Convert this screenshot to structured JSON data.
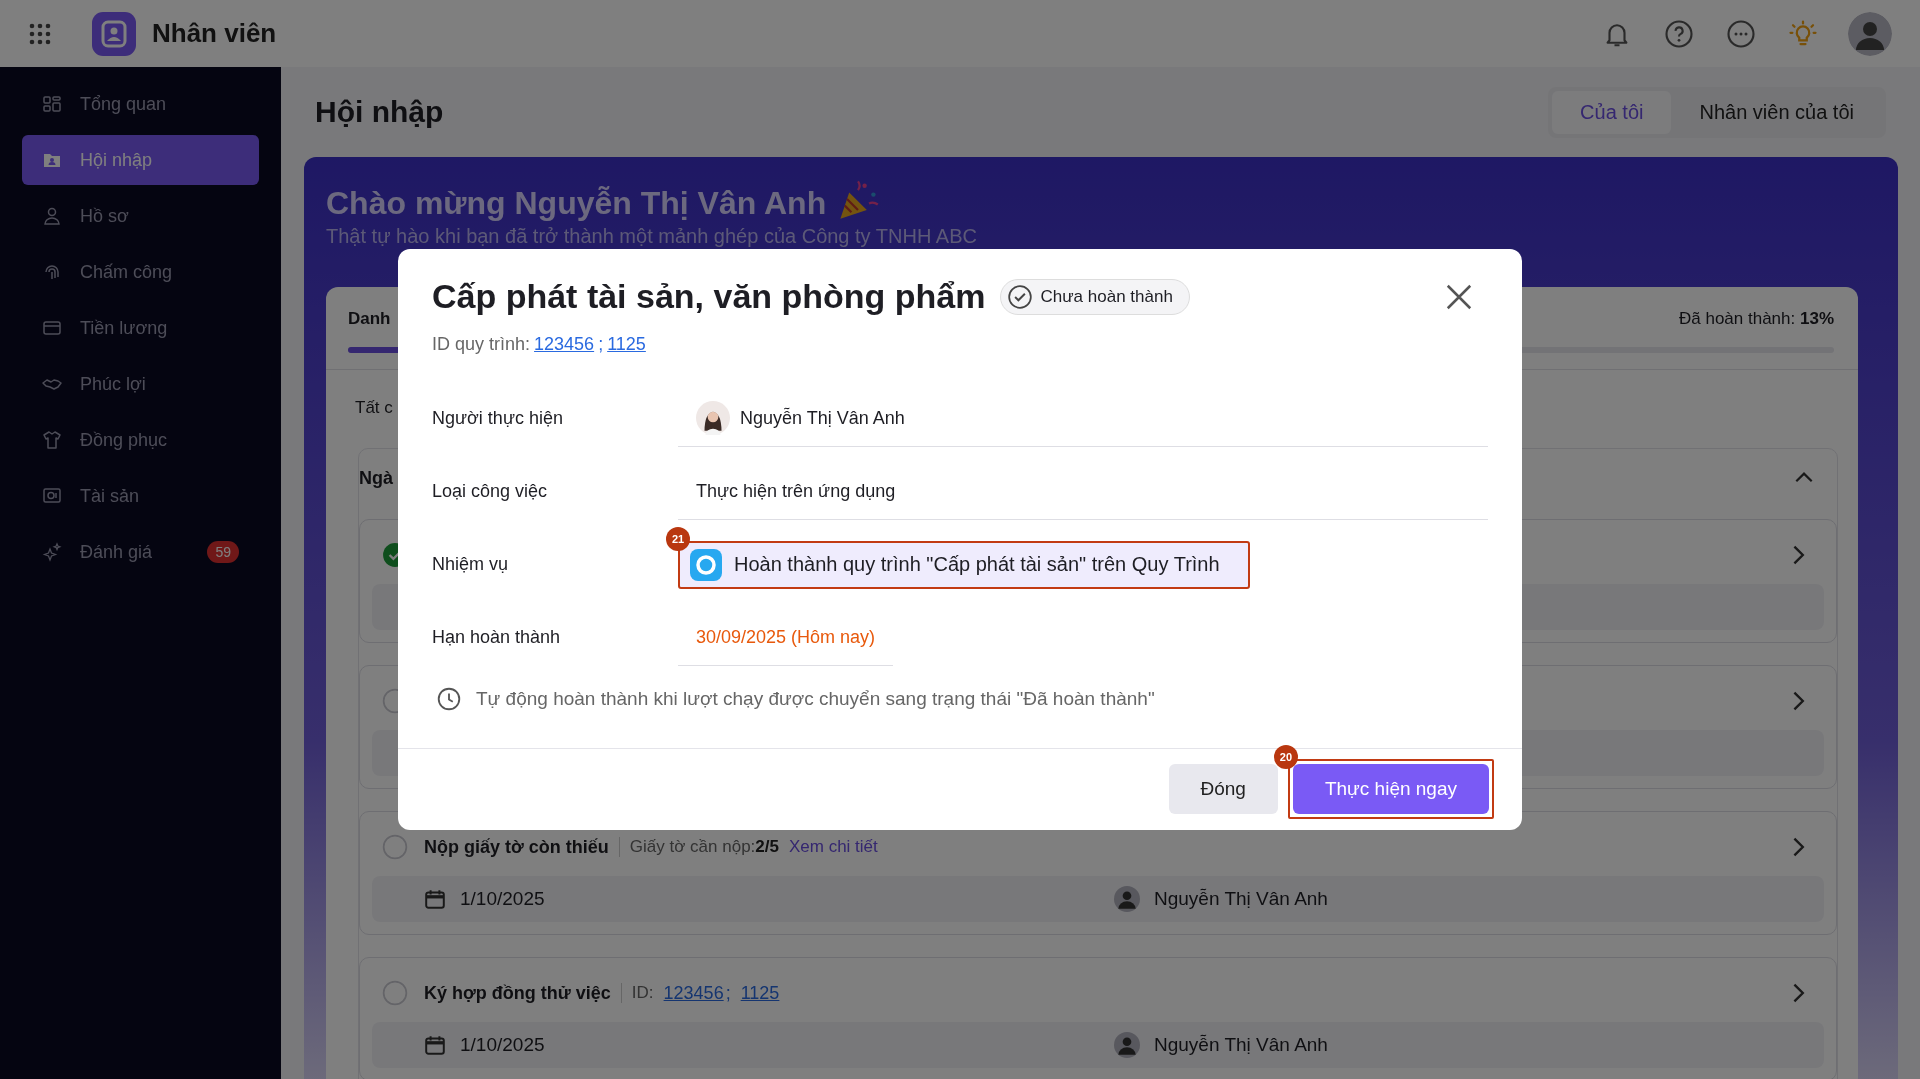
{
  "topbar": {
    "app_name": "Nhân viên"
  },
  "sidebar": {
    "items": [
      {
        "label": "Tổng quan",
        "selected": false
      },
      {
        "label": "Hội nhập",
        "selected": true
      },
      {
        "label": "Hồ sơ",
        "selected": false
      },
      {
        "label": "Chấm công",
        "selected": false
      },
      {
        "label": "Tiền lương",
        "selected": false
      },
      {
        "label": "Phúc lợi",
        "selected": false
      },
      {
        "label": "Đồng phục",
        "selected": false
      },
      {
        "label": "Tài sản",
        "selected": false
      },
      {
        "label": "Đánh giá",
        "selected": false,
        "badge": "59"
      }
    ]
  },
  "page": {
    "title": "Hội nhập",
    "tabs": [
      {
        "label": "Của tôi",
        "selected": true
      },
      {
        "label": "Nhân viên của tôi",
        "selected": false
      }
    ]
  },
  "banner": {
    "title": "Chào mừng Nguyễn Thị Vân Anh",
    "subtitle": "Thật tự hào khi bạn đã trở thành một mảnh ghép của Công ty TNHH ABC"
  },
  "checklist": {
    "tab_label": "Danh",
    "progress_label": "Đã hoàn thành:",
    "progress_value": "13%",
    "level": 0.13,
    "filter": "Tất c",
    "group": {
      "title": "Ngà",
      "expanded": true,
      "items": [
        {
          "checked": true
        },
        {
          "checked": false
        },
        {
          "checked": false,
          "title": "Nộp giấy tờ còn thiếu",
          "meta_label": "Giấy tờ cần nộp:",
          "meta_value": "2/5",
          "link": "Xem chi tiết",
          "date": "1/10/2025",
          "assignee": "Nguyễn Thị Vân Anh"
        },
        {
          "checked": false,
          "title": "Ký hợp đồng thử việc",
          "meta_label": "ID:",
          "ids": [
            "123456",
            "1125"
          ],
          "separator": ";",
          "date": "1/10/2025",
          "assignee": "Nguyễn Thị Vân Anh"
        }
      ]
    }
  },
  "modal": {
    "title": "Cấp phát tài sản, văn phòng phẩm",
    "status": "Chưa hoàn thành",
    "id_label": "ID quy trình:",
    "ids": [
      "123456",
      "1125"
    ],
    "separator": ";",
    "fields": [
      {
        "kind": "person",
        "label": "Người thực hiện",
        "value": "Nguyễn Thị Vân Anh"
      },
      {
        "kind": "text",
        "label": "Loại công việc",
        "value": "Thực hiện trên ứng dụng"
      },
      {
        "kind": "task",
        "label": "Nhiệm vụ",
        "value": "Hoàn thành quy trình \"Cấp phát tài sản\" trên Quy Trình",
        "marker": "21"
      },
      {
        "kind": "deadline",
        "label": "Hạn hoàn thành",
        "value": "30/09/2025 (Hôm nay)"
      }
    ],
    "note": "Tự động hoàn thành khi lượt chạy được chuyển sang trạng thái \"Đã hoàn thành\"",
    "buttons": [
      {
        "kind": "secondary",
        "label": "Đóng"
      },
      {
        "kind": "primary",
        "label": "Thực hiện ngay",
        "marker": "20"
      }
    ]
  }
}
